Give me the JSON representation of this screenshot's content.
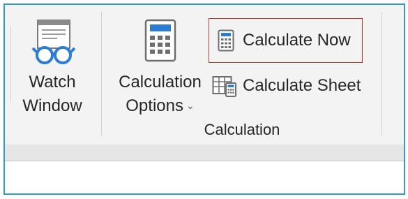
{
  "ribbon": {
    "watch_window": {
      "label_line1": "Watch",
      "label_line2": "Window",
      "icon": "watch-window-icon"
    },
    "calculation_options": {
      "label_line1": "Calculation",
      "label_line2": "Options",
      "dropdown_glyph": "⌄",
      "icon": "calculator-icon"
    },
    "calculate_now": {
      "label": "Calculate Now",
      "icon": "calculator-small-icon"
    },
    "calculate_sheet": {
      "label": "Calculate Sheet",
      "icon": "sheet-calculator-icon"
    },
    "group_label": "Calculation"
  },
  "colors": {
    "frame_border": "#2e9bd6",
    "highlight_border": "#c0392b",
    "ribbon_bg": "#f3f3f3"
  }
}
